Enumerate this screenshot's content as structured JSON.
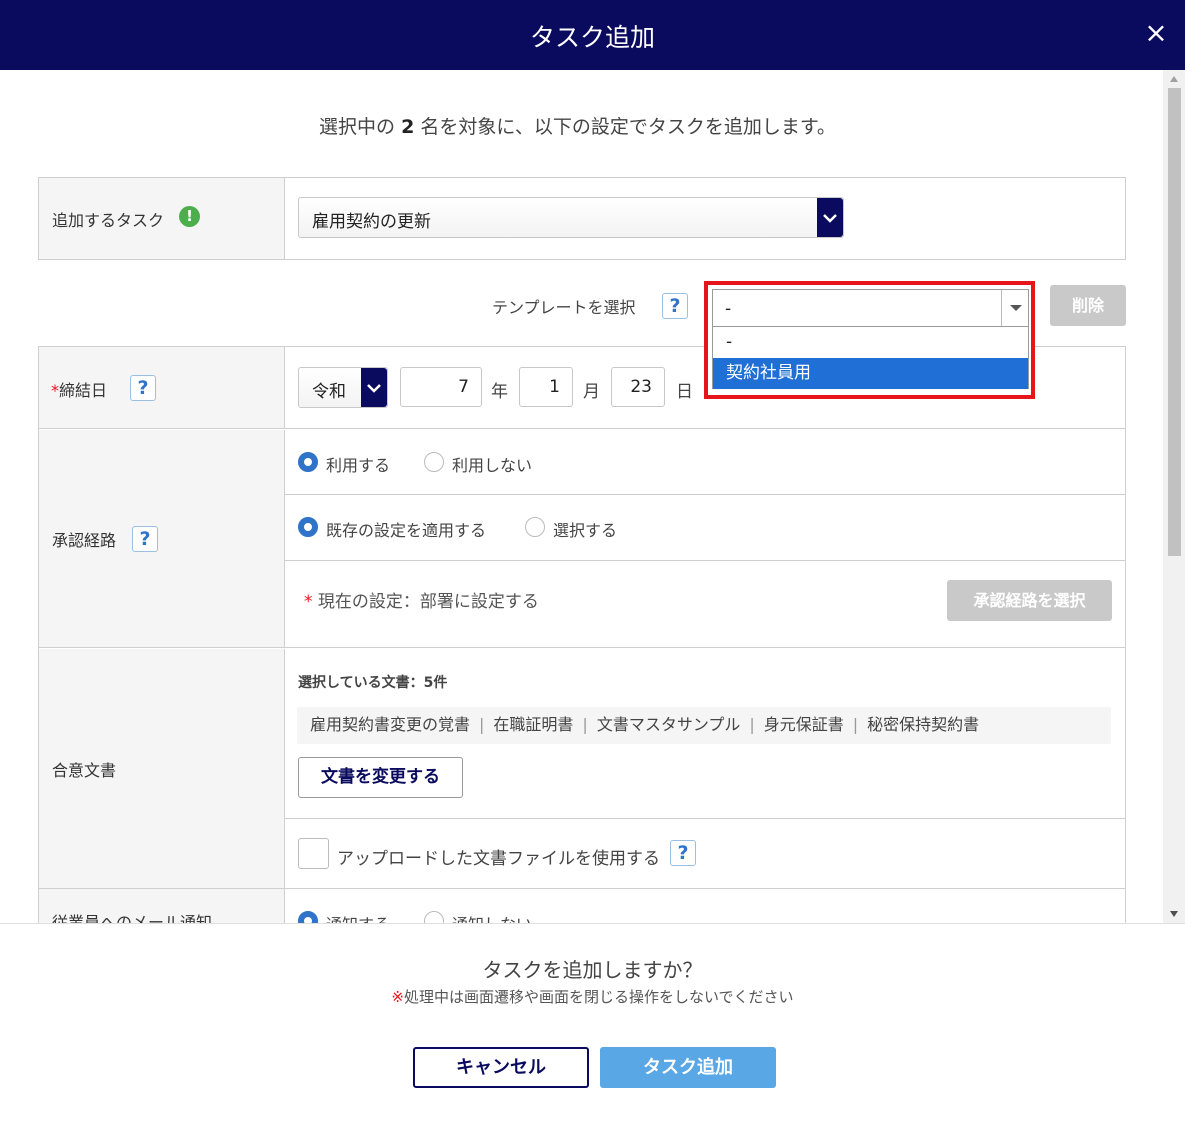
{
  "dialog": {
    "title": "タスク追加",
    "close_icon": "×"
  },
  "intro": {
    "prefix": "選択中の",
    "count": "2",
    "suffix": "名を対象に、以下の設定でタスクを追加します。"
  },
  "task_row": {
    "label": "追加するタスク",
    "warn_icon": "!",
    "selected": "雇用契約の更新"
  },
  "template": {
    "label": "テンプレートを選択",
    "help": "?",
    "selected": "-",
    "options": [
      "-",
      "契約社員用"
    ],
    "highlighted_option": "契約社員用",
    "delete_label": "削除"
  },
  "date_row": {
    "required_mark": "*",
    "label": "締結日",
    "help": "?",
    "era": "令和",
    "year": "7",
    "year_unit": "年",
    "month": "1",
    "month_unit": "月",
    "day": "23",
    "day_unit": "日"
  },
  "approval": {
    "label": "承認経路",
    "help": "?",
    "use_label": "利用する",
    "nouse_label": "利用しない",
    "use_selected": true,
    "apply_existing_label": "既存の設定を適用する",
    "select_label": "選択する",
    "current_mark": "*",
    "current_text": "現在の設定：部署に設定する",
    "select_route_button": "承認経路を選択"
  },
  "documents": {
    "label": "合意文書",
    "selected_header": "選択している文書：5件",
    "items": [
      "雇用契約書変更の覚書",
      "在職証明書",
      "文書マスタサンプル",
      "身元保証書",
      "秘密保持契約書"
    ],
    "change_button": "文書を変更する",
    "upload_label": "アップロードした文書ファイルを使用する",
    "upload_help": "?"
  },
  "mail": {
    "label": "従業員へのメール通知",
    "notify_label": "通知する",
    "no_notify_label": "通知しない"
  },
  "footer": {
    "question": "タスクを追加しますか？",
    "note_mark": "※",
    "note": "処理中は画面遷移や画面を閉じる操作をしないでください",
    "cancel_label": "キャンセル",
    "add_label": "タスク追加"
  },
  "colors": {
    "header": "#0a0b5e",
    "accent": "#2f74c9",
    "highlight_border": "#e8141b",
    "primary_button": "#5aa7e6"
  }
}
